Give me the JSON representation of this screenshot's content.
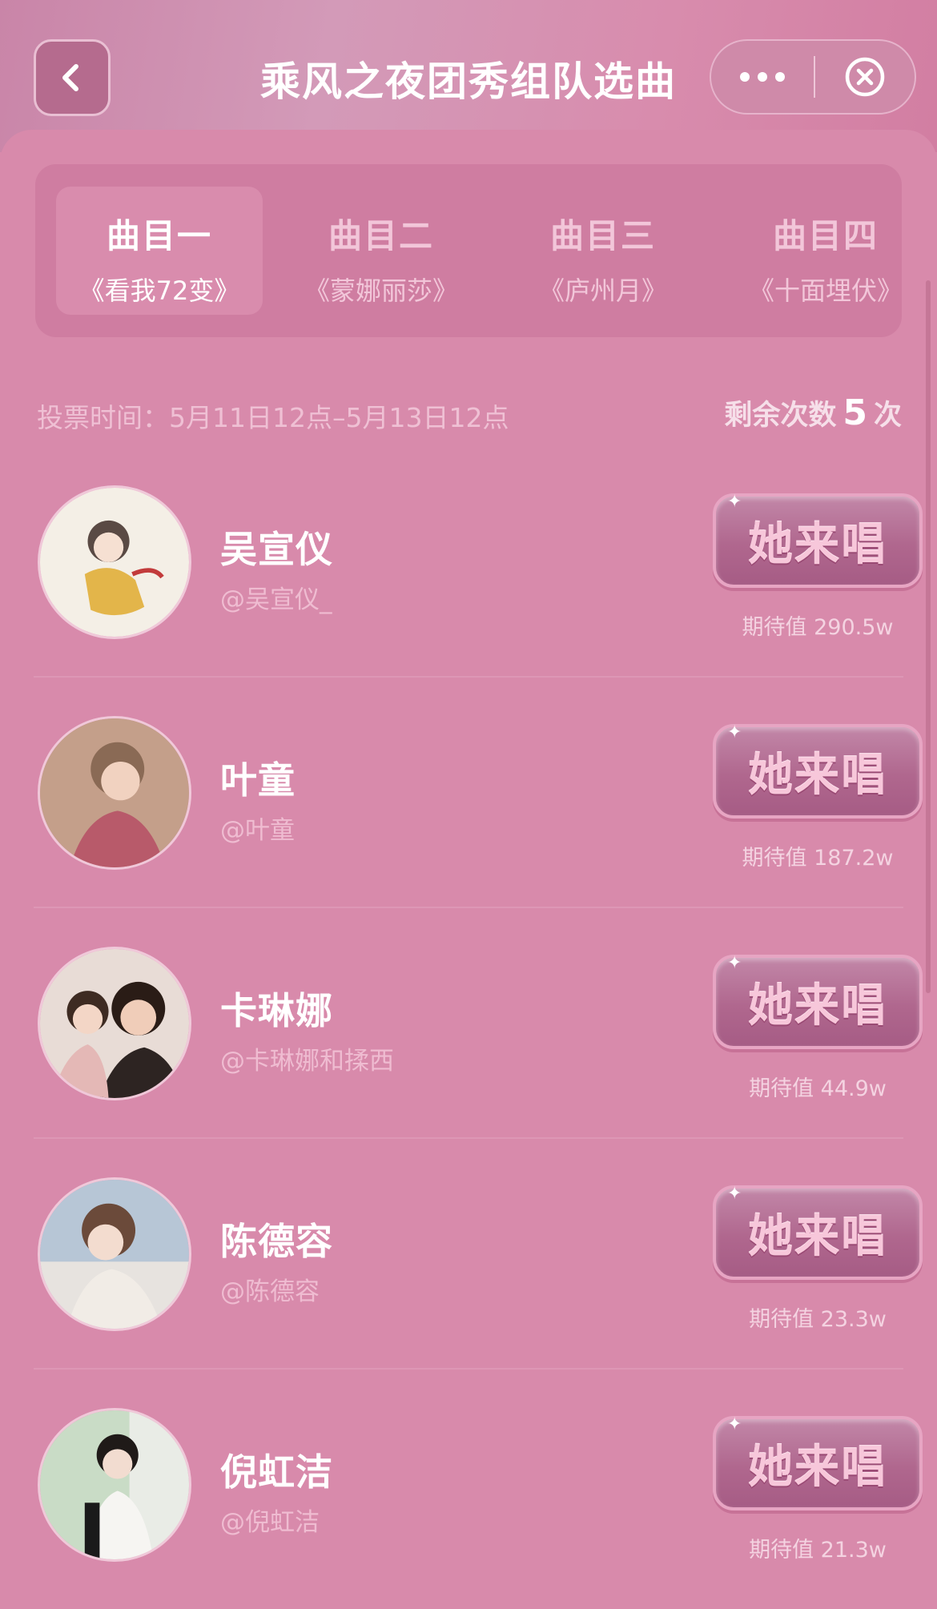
{
  "header": {
    "title": "乘风之夜团秀组队选曲",
    "back_icon": "chevron-left-icon",
    "more_icon": "more-dots-icon",
    "close_icon": "close-circle-icon"
  },
  "tabs": [
    {
      "name": "曲目一",
      "song": "《看我72变》",
      "active": true
    },
    {
      "name": "曲目二",
      "song": "《蒙娜丽莎》",
      "active": false
    },
    {
      "name": "曲目三",
      "song": "《庐州月》",
      "active": false
    },
    {
      "name": "曲目四",
      "song": "《十面埋伏》",
      "active": false
    }
  ],
  "vote": {
    "time_text": "投票时间：5月11日12点–5月13日12点",
    "remaining_label": "剩余次数",
    "remaining_count": "5",
    "remaining_unit": "次"
  },
  "candidates": [
    {
      "name": "吴宣仪",
      "handle": "@吴宣仪_",
      "button": "她来唱",
      "expect": "期待值  290.5w"
    },
    {
      "name": "叶童",
      "handle": "@叶童",
      "button": "她来唱",
      "expect": "期待值  187.2w"
    },
    {
      "name": "卡琳娜",
      "handle": "@卡琳娜和揉西",
      "button": "她来唱",
      "expect": "期待值  44.9w"
    },
    {
      "name": "陈德容",
      "handle": "@陈德容",
      "button": "她来唱",
      "expect": "期待值  23.3w"
    },
    {
      "name": "倪虹洁",
      "handle": "@倪虹洁",
      "button": "她来唱",
      "expect": "期待值  21.3w"
    }
  ],
  "colors": {
    "background": "#d98aab",
    "tab_panel": "#cf7da1",
    "button": "#b0678e"
  }
}
